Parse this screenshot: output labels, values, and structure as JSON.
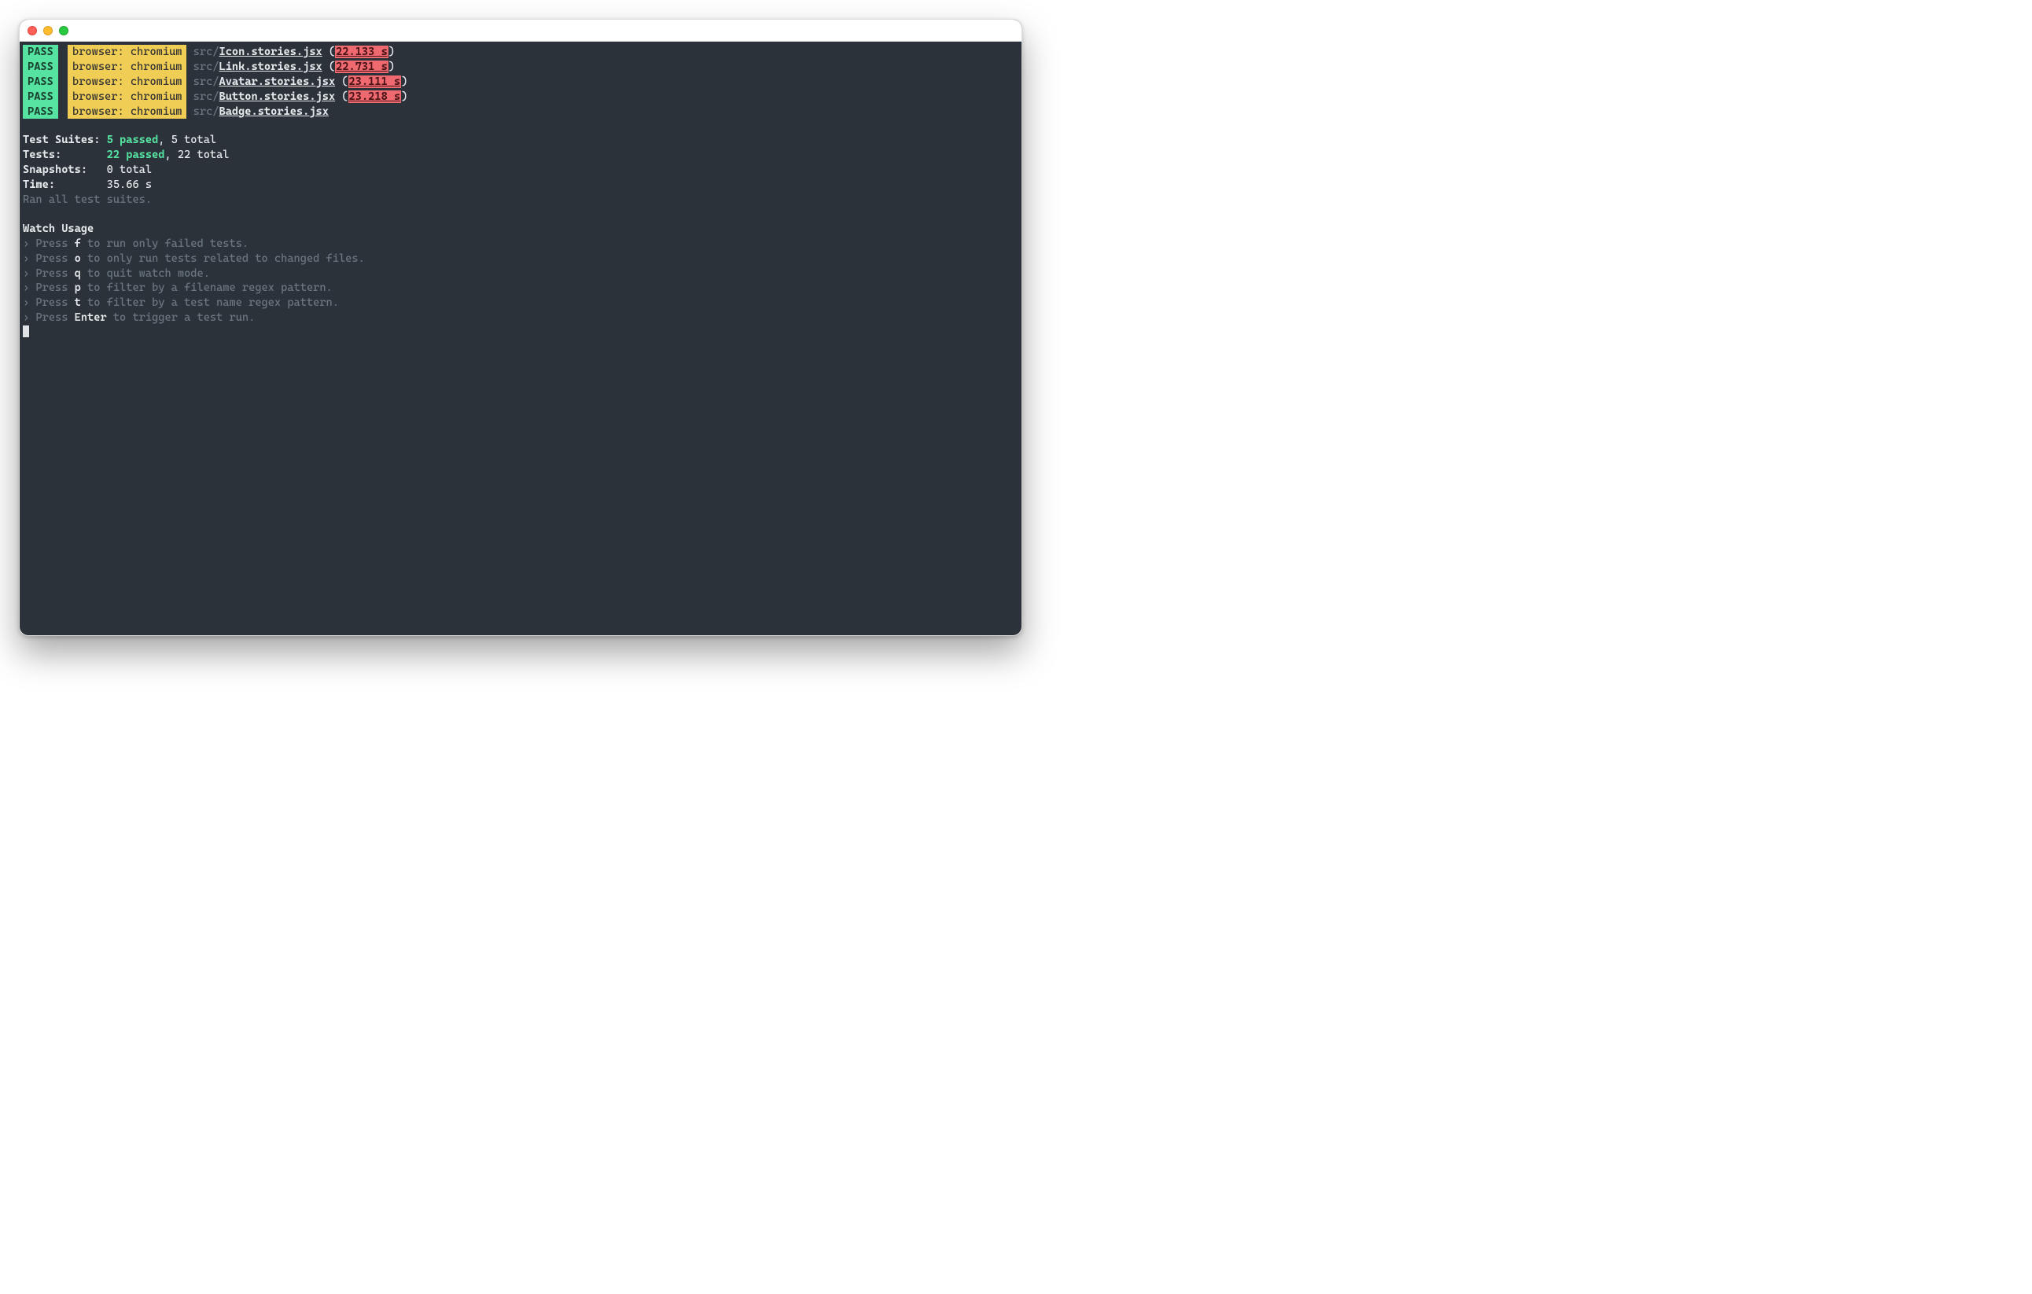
{
  "titlebar": {
    "close_label": "close",
    "minimize_label": "minimize",
    "zoom_label": "zoom"
  },
  "results": [
    {
      "status": "PASS",
      "browser": "browser: chromium",
      "dir": "src/",
      "file": "Icon.stories.jsx",
      "time": "22.133 s"
    },
    {
      "status": "PASS",
      "browser": "browser: chromium",
      "dir": "src/",
      "file": "Link.stories.jsx",
      "time": "22.731 s"
    },
    {
      "status": "PASS",
      "browser": "browser: chromium",
      "dir": "src/",
      "file": "Avatar.stories.jsx",
      "time": "23.111 s"
    },
    {
      "status": "PASS",
      "browser": "browser: chromium",
      "dir": "src/",
      "file": "Button.stories.jsx",
      "time": "23.218 s"
    },
    {
      "status": "PASS",
      "browser": "browser: chromium",
      "dir": "src/",
      "file": "Badge.stories.jsx",
      "time": ""
    }
  ],
  "summary": {
    "suites_label": "Test Suites: ",
    "suites_passed": "5 passed",
    "suites_total": ", 5 total",
    "tests_label": "Tests:       ",
    "tests_passed": "22 passed",
    "tests_total": ", 22 total",
    "snapshots_label": "Snapshots:   ",
    "snapshots_value": "0 total",
    "time_label": "Time:        ",
    "time_value": "35.66 s",
    "ran": "Ran all test suites."
  },
  "watch": {
    "title": "Watch Usage",
    "items": [
      {
        "prefix": " › Press ",
        "key": "f",
        "suffix": " to run only failed tests."
      },
      {
        "prefix": " › Press ",
        "key": "o",
        "suffix": " to only run tests related to changed files."
      },
      {
        "prefix": " › Press ",
        "key": "q",
        "suffix": " to quit watch mode."
      },
      {
        "prefix": " › Press ",
        "key": "p",
        "suffix": " to filter by a filename regex pattern."
      },
      {
        "prefix": " › Press ",
        "key": "t",
        "suffix": " to filter by a test name regex pattern."
      },
      {
        "prefix": " › Press ",
        "key": "Enter",
        "suffix": " to trigger a test run."
      }
    ]
  }
}
